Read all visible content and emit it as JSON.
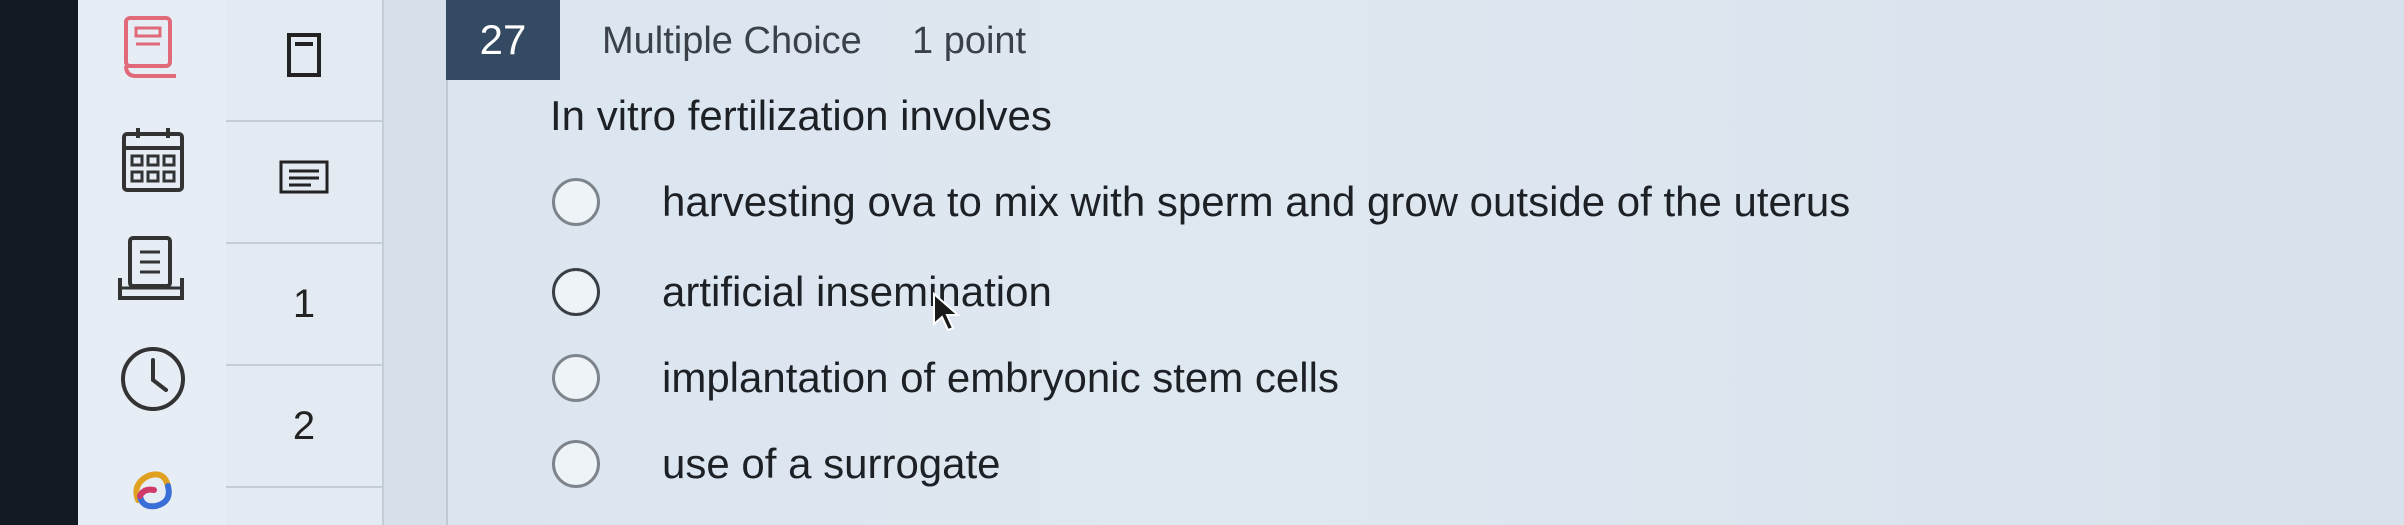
{
  "navigator": {
    "items": [
      {
        "label": ""
      },
      {
        "label": ""
      },
      {
        "label": "1"
      },
      {
        "label": "2"
      }
    ]
  },
  "question": {
    "number": "27",
    "type": "Multiple Choice",
    "points": "1 point",
    "prompt": "In vitro fertilization involves",
    "options": [
      {
        "label": "harvesting ova to mix with sperm and grow outside of the uterus"
      },
      {
        "label": "artificial insemination"
      },
      {
        "label": "implantation of embryonic stem cells"
      },
      {
        "label": "use of a surrogate"
      }
    ]
  },
  "colors": {
    "accent": "#e06a7a",
    "header_bg": "#344a63"
  },
  "icons": [
    "ebook-icon",
    "calendar-icon",
    "notes-icon",
    "clock-icon",
    "swirl-logo-icon",
    "bookmark-icon",
    "list-icon",
    "cursor-icon"
  ]
}
